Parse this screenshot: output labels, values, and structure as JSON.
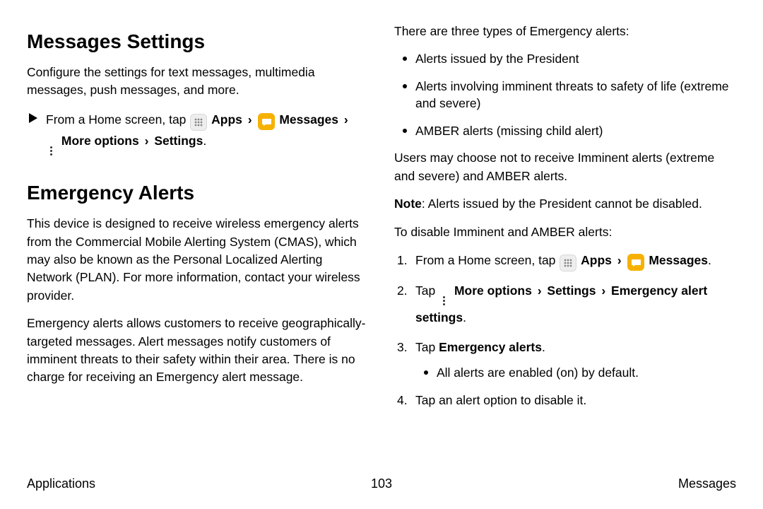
{
  "left": {
    "h1a": "Messages Settings",
    "p1": "Configure the settings for text messages, multimedia messages, push messages, and more.",
    "from_home": "From a Home screen, tap",
    "apps": "Apps",
    "messages": "Messages",
    "more_opts": "More options",
    "settings": "Settings",
    "h1b": "Emergency Alerts",
    "p2": "This device is designed to receive wireless emergency alerts from the Commercial Mobile Alerting System (CMAS), which may also be known as the Personal Localized Alerting Network (PLAN). For more information, contact your wireless provider.",
    "p3": "Emergency alerts allows customers to receive geographically-targeted messages. Alert messages notify customers of imminent threats to their safety within their area. There is no charge for receiving an Emergency alert message."
  },
  "right": {
    "intro": "There are three types of Emergency alerts:",
    "b1": "Alerts issued by the President",
    "b2": "Alerts involving imminent threats to safety of life (extreme and severe)",
    "b3": "AMBER alerts (missing child alert)",
    "p4": "Users may choose not to receive Imminent alerts (extreme and severe) and AMBER alerts.",
    "note_label": "Note",
    "note_body": ": Alerts issued by the President cannot be disabled.",
    "p5": "To disable Imminent and AMBER alerts:",
    "s1_pre": "From a Home screen, tap",
    "apps": "Apps",
    "messages": "Messages",
    "s2_pre": "Tap",
    "more_opts": "More options",
    "settings": "Settings",
    "em_set": "Emergency alert settings",
    "s3_pre": "Tap ",
    "s3_bold": "Emergency alerts",
    "s3_sub": "All alerts are enabled (on) by default.",
    "s4": "Tap an alert option to disable it."
  },
  "footer": {
    "left": "Applications",
    "center": "103",
    "right": "Messages"
  }
}
